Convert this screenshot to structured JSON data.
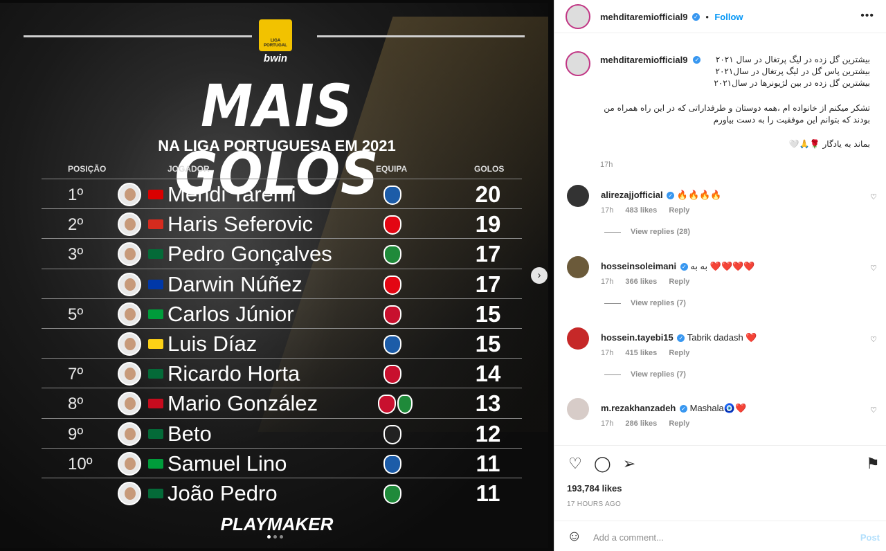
{
  "graphic": {
    "logo_text": "LIGA PORTUGAL",
    "logo_sub": "bwin",
    "title": "MAIS GOLOS",
    "subtitle": "NA LIGA PORTUGUESA EM 2021",
    "headers": {
      "position": "POSIÇÃO",
      "player": "JOGADOR",
      "team": "EQUIPA",
      "goals": "GOLOS"
    },
    "rows": [
      {
        "pos": "1º",
        "name": "Mehdi Taremi",
        "goals": "20"
      },
      {
        "pos": "2º",
        "name": "Haris Seferovic",
        "goals": "19"
      },
      {
        "pos": "3º",
        "name": "Pedro Gonçalves",
        "goals": "17"
      },
      {
        "pos": "",
        "name": "Darwin Núñez",
        "goals": "17"
      },
      {
        "pos": "5º",
        "name": "Carlos Júnior",
        "goals": "15"
      },
      {
        "pos": "",
        "name": "Luis Díaz",
        "goals": "15"
      },
      {
        "pos": "7º",
        "name": "Ricardo Horta",
        "goals": "14"
      },
      {
        "pos": "8º",
        "name": "Mario González",
        "goals": "13"
      },
      {
        "pos": "9º",
        "name": "Beto",
        "goals": "12"
      },
      {
        "pos": "10º",
        "name": "Samuel Lino",
        "goals": "11"
      },
      {
        "pos": "",
        "name": "João Pedro",
        "goals": "11"
      }
    ],
    "flags": [
      "#da0000",
      "#d52b1e",
      "#046a38",
      "#0038a8",
      "#009c3b",
      "#fcd116",
      "#046a38",
      "#c60b1e",
      "#046a38",
      "#009c3b",
      "#046a38"
    ],
    "crests": [
      "#1c5ca8",
      "#e30613",
      "#1f8a3a",
      "#e30613",
      "#c8102e",
      "#1c5ca8",
      "#c8102e",
      "#c8102e",
      "#222222",
      "#1c5ca8",
      "#1f8a3a"
    ],
    "brand": "PLAYMAKER",
    "next_icon": "›"
  },
  "panel": {
    "author": "mehditaremiofficial9",
    "follow": "Follow",
    "more": "•••",
    "caption_lines": [
      "بیشترین گل زده در لیگ پرتغال در سال ۲۰۲۱",
      "بیشترین پاس گل در لیگ پرتغال در سال۲۰۲۱",
      "بیشترین گل زده در بین لژیونرها در سال۲۰۲۱",
      "تشکر میکنم از خانواده ام ،همه دوستان و طرفداراتی که در این راه همراه من بودند که بتوانم این موفقیت را به دست بیاورم",
      "بماند به یادگار 🌹🙏🤍"
    ],
    "caption_time": "17h",
    "comments": [
      {
        "user": "alirezajjofficial",
        "text": "🔥🔥🔥🔥",
        "time": "17h",
        "likes": "483 likes",
        "reply": "Reply",
        "view": "View replies (28)"
      },
      {
        "user": "hosseinsoleimani",
        "text": "به به ❤️❤️❤️❤️",
        "time": "17h",
        "likes": "366 likes",
        "reply": "Reply",
        "view": "View replies (7)"
      },
      {
        "user": "hossein.tayebi15",
        "text": "Tabrik dadash ❤️",
        "time": "17h",
        "likes": "415 likes",
        "reply": "Reply",
        "view": "View replies (7)"
      },
      {
        "user": "m.rezakhanzadeh",
        "text": "Mashala🧿❤️",
        "time": "17h",
        "likes": "286 likes",
        "reply": "Reply",
        "view": ""
      }
    ],
    "likes": "193,784 likes",
    "posted": "17 HOURS AGO",
    "add_comment_placeholder": "Add a comment...",
    "post": "Post",
    "icons": {
      "like": "♡",
      "comment": "◯",
      "share": "➢",
      "save": "⚑",
      "emoji": "☺",
      "comment_like": "♡"
    }
  }
}
